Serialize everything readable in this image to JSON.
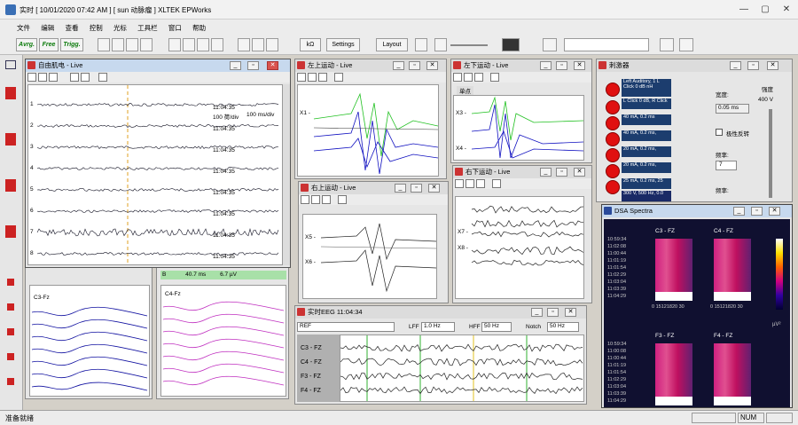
{
  "titlebar": {
    "title": "实时  [ 10/01/2020 07:42 AM ]  [ sun  动脉瘤 ]   XLTEK EPWorks",
    "min": "—",
    "max": "▢",
    "close": "✕"
  },
  "menu": [
    "文件",
    "编辑",
    "查看",
    "控制",
    "光标",
    "工具栏",
    "窗口",
    "帮助"
  ],
  "toolbar": {
    "avrg": "Avrg.",
    "free": "Free",
    "trigg": "Trigg.",
    "impedance": "kΩ",
    "settings": "Settings",
    "layout": "Layout"
  },
  "windows": {
    "free_emg": {
      "title": "自由肌电 - Live",
      "channels": [
        "1",
        "2",
        "3",
        "4",
        "5",
        "6",
        "7",
        "8"
      ],
      "times": [
        "11:04:35",
        "11:04:35",
        "11:04:35",
        "11:04:35",
        "11:04:35",
        "11:04:35",
        "11:04:35",
        "11:04:35"
      ],
      "scale": "100 ms/div",
      "sens": "100 荷/div"
    },
    "upper_left": {
      "title": "左上运动 - Live",
      "ch1": "X1 -"
    },
    "lower_left": {
      "title": "左下运动 - Live",
      "tab": "单点",
      "ch3": "X3 -",
      "ch4": "X4 -"
    },
    "upper_right": {
      "title": "右上运动 - Live",
      "ch5": "X5 -",
      "ch6": "X6 -"
    },
    "lower_right": {
      "title": "右下运动 - Live",
      "ch7": "X7 -",
      "ch8": "X8 -"
    },
    "stimulator": {
      "title": "刺激器",
      "rows": [
        "Left Auditory, 1 L Click 0 dB nH",
        "L Click 0 dB, R Click",
        "40 mA, 0.2 ms",
        "40 mA, 0.2 ms,",
        "20 mA, 0.2 ms,",
        "20 mA, 0.2 ms,",
        "25 mA, 0.2 ms, 25",
        "300 V, 500 Hz, 0.0"
      ],
      "duration_label": "宽度:",
      "duration": "0.05 ms",
      "polarity": "极性反转",
      "rate_label": "频率:",
      "rate": "7",
      "freq_label": "频率:",
      "intensity_label": "强度",
      "intensity": "400 V"
    },
    "dsa": {
      "title": "DSA Spectra",
      "montages": [
        "C3 - FZ",
        "C4 - FZ",
        "F3 - FZ",
        "F4 - FZ"
      ],
      "times_top": [
        "10:59:34",
        "11:02:08",
        "11:00:44",
        "11:01:19",
        "11:01:54",
        "11:02:29",
        "11:03:04",
        "11:03:39",
        "11:04:29"
      ],
      "times_bottom": [
        "10:59:34",
        "11:00:08",
        "11:00:44",
        "11:01:19",
        "11:01:54",
        "11:02:29",
        "11:03:04",
        "11:03:39",
        "11:04:29"
      ],
      "axis": "0 15121820 30",
      "unit": "µV²"
    },
    "eeg": {
      "title": "实时EEG  11:04:34",
      "ref": "REF",
      "lff_label": "LFF",
      "lff": "1.0 Hz",
      "hff_label": "HFF",
      "hff": "50 Hz",
      "notch_label": "Notch",
      "notch": "50 Hz",
      "channels": [
        "C3 - FZ",
        "C4 - FZ",
        "F3 - FZ",
        "F4 - FZ"
      ]
    },
    "sep_a": {
      "ch": "C3-Fz"
    },
    "sep_b": {
      "tag": "B",
      "lat": "40.7 ms",
      "amp": "6.7 µV",
      "ch": "C4-Fz"
    }
  },
  "status": {
    "left": "准备就绪",
    "num": "NUM"
  },
  "colors": {
    "green": "#20c020",
    "blue": "#1010c0",
    "magenta": "#c030c0",
    "navy": "#1c3d6e"
  }
}
